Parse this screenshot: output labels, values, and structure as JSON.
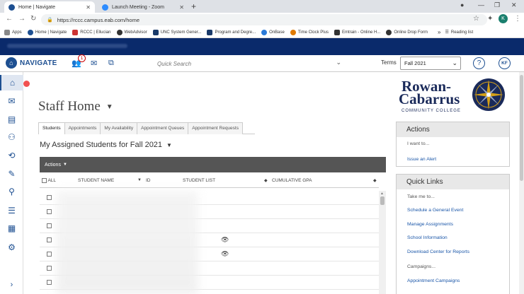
{
  "browser": {
    "tabs": [
      {
        "title": "Home | Navigate",
        "favicon_color": "#1d4f91",
        "active": true
      },
      {
        "title": "Launch Meeting - Zoom",
        "favicon_color": "#2d8cff",
        "active": false
      }
    ],
    "new_tab": "+",
    "url": "https://rccc.campus.eab.com/home",
    "profile_initial": "K",
    "bookmarks": [
      {
        "label": "Apps",
        "color": "#888"
      },
      {
        "label": "Home | Navigate",
        "color": "#1d4f91"
      },
      {
        "label": "RCCC | Ellucian",
        "color": "#c33"
      },
      {
        "label": "WebAdvisor",
        "color": "#333"
      },
      {
        "label": "UNC System Gener...",
        "color": "#1a3a6a"
      },
      {
        "label": "Program and Degre...",
        "color": "#1a3a6a"
      },
      {
        "label": "OnBase",
        "color": "#2a7ad8"
      },
      {
        "label": "Time Clock Plus",
        "color": "#e07a00"
      },
      {
        "label": "Emtrain - Online H...",
        "color": "#333"
      },
      {
        "label": "Online Drop Form",
        "color": "#333"
      }
    ],
    "more_bookmarks": "»",
    "reading_list": "Reading list"
  },
  "app": {
    "brand": "NAVIGATE",
    "notification_count": "1",
    "search_placeholder": "Quick Search",
    "terms_label": "Terms",
    "terms_value": "Fall 2021",
    "help": "?",
    "user_initials": "KF"
  },
  "sidebar": {
    "items": [
      "home-icon",
      "mail-icon",
      "id-card-icon",
      "people-icon",
      "history-icon",
      "pin-icon",
      "search-icon",
      "list-icon",
      "report-icon",
      "gear-icon"
    ],
    "collapse": "›"
  },
  "main": {
    "title": "Staff Home",
    "tabs": [
      "Students",
      "Appointments",
      "My Availability",
      "Appointment Queues",
      "Appointment Requests"
    ],
    "subtitle": "My Assigned Students for Fall 2021",
    "actions_label": "Actions",
    "columns": {
      "all": "ALL",
      "student_name": "STUDENT NAME",
      "id": "ID",
      "student_list": "STUDENT LIST",
      "cumulative_gpa": "CUMULATIVE GPA"
    }
  },
  "logo": {
    "line1": "Rowan-",
    "line2": "Cabarrus",
    "line3": "COMMUNITY COLLEGE",
    "colors": {
      "navy": "#1a2a5a",
      "gold": "#d4a017"
    }
  },
  "actions_panel": {
    "title": "Actions",
    "prompt": "I want to...",
    "items": [
      "Issue an Alert"
    ]
  },
  "quick_links": {
    "title": "Quick Links",
    "prompt": "Take me to...",
    "items": [
      "Schedule a General Event",
      "Manage Assignments",
      "School Information",
      "Download Center for Reports"
    ],
    "campaigns_prompt": "Campaigns...",
    "campaigns": [
      "Appointment Campaigns"
    ]
  }
}
